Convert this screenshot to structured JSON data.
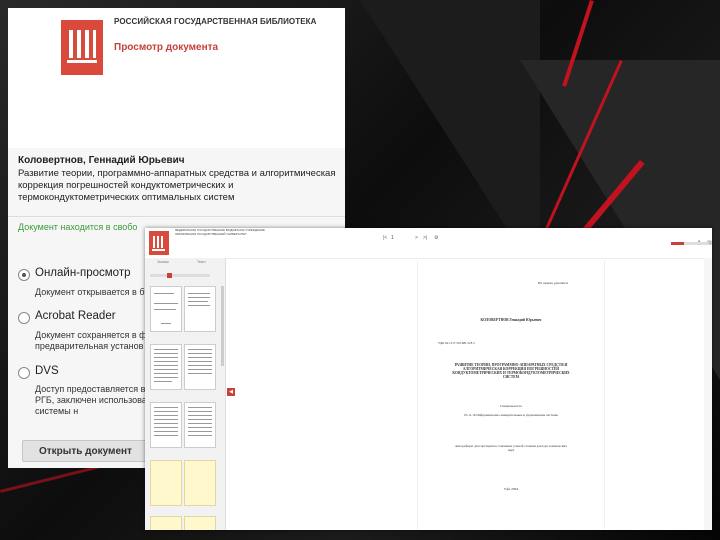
{
  "rsl_window": {
    "org_name": "РОССИЙСКАЯ ГОСУДАРСТВЕННАЯ БИБЛИОТЕКА",
    "view_title": "Просмотр документа",
    "author": "Коловертнов, Геннадий Юрьевич",
    "doc_title": "Развитие теории, программно-аппаратных средства и алгоритмическая коррекция погрешностей кондуктометрических и термокондуктометрических оптимальных систем",
    "notice": "Документ находится в свобо",
    "options": [
      {
        "label": "Онлайн-просмотр",
        "desc": "Документ открывается в б",
        "selected": true
      },
      {
        "label": "Acrobat Reader",
        "desc": "Документ сохраняется в ф предварительная установ",
        "selected": false
      },
      {
        "label": "DVS",
        "desc": "Доступ предоставляется в читателям РГБ, заключен использования системы н",
        "selected": false
      }
    ],
    "open_button": "Открыть документ"
  },
  "viewer": {
    "header_org": "ФЕДЕРАЛЬНОЕ ГОСУДАРСТВЕННОЕ БЮДЖЕТНОЕ УЧРЕЖДЕНИЕ ОБРАЗОВАНИЯ ГОСУДАРСТВЕННЫЙ УНИВЕРСИТЕТ",
    "sidebar_tabs": [
      "Эскизы",
      "Текст"
    ],
    "page_number": "1",
    "zoom_fraction": 0.35,
    "page": {
      "header_right": "На правах рукописи",
      "author_caps": "КОЛОВЕРТНОВ Геннадий Юрьевич",
      "udc": "УДК 621.317.332:681.518.3",
      "title_caps": "РАЗВИТИЕ ТЕОРИИ, ПРОГРАММНО-АППАРАТНЫХ СРЕДСТВ И АЛГОРИТМИЧЕСКАЯ КОРРЕКЦИЯ ПОГРЕШНОСТЕЙ КОНДУКТОМЕТРИЧЕСКИХ И ТЕРМОКОНДУКТОМЕТРИЧЕСКИХ СИСТЕМ",
      "specialty_label": "Специальность",
      "specialty": "05.11.16 Информационно-измерительные и управляющие системы",
      "degree": "Автореферат диссертации на соискание ученой степени доктора технических наук",
      "city_year": "Уфа 2004"
    }
  },
  "colors": {
    "accent": "#c8403a",
    "green": "#3c9a3c",
    "streak": "#c1121f"
  }
}
